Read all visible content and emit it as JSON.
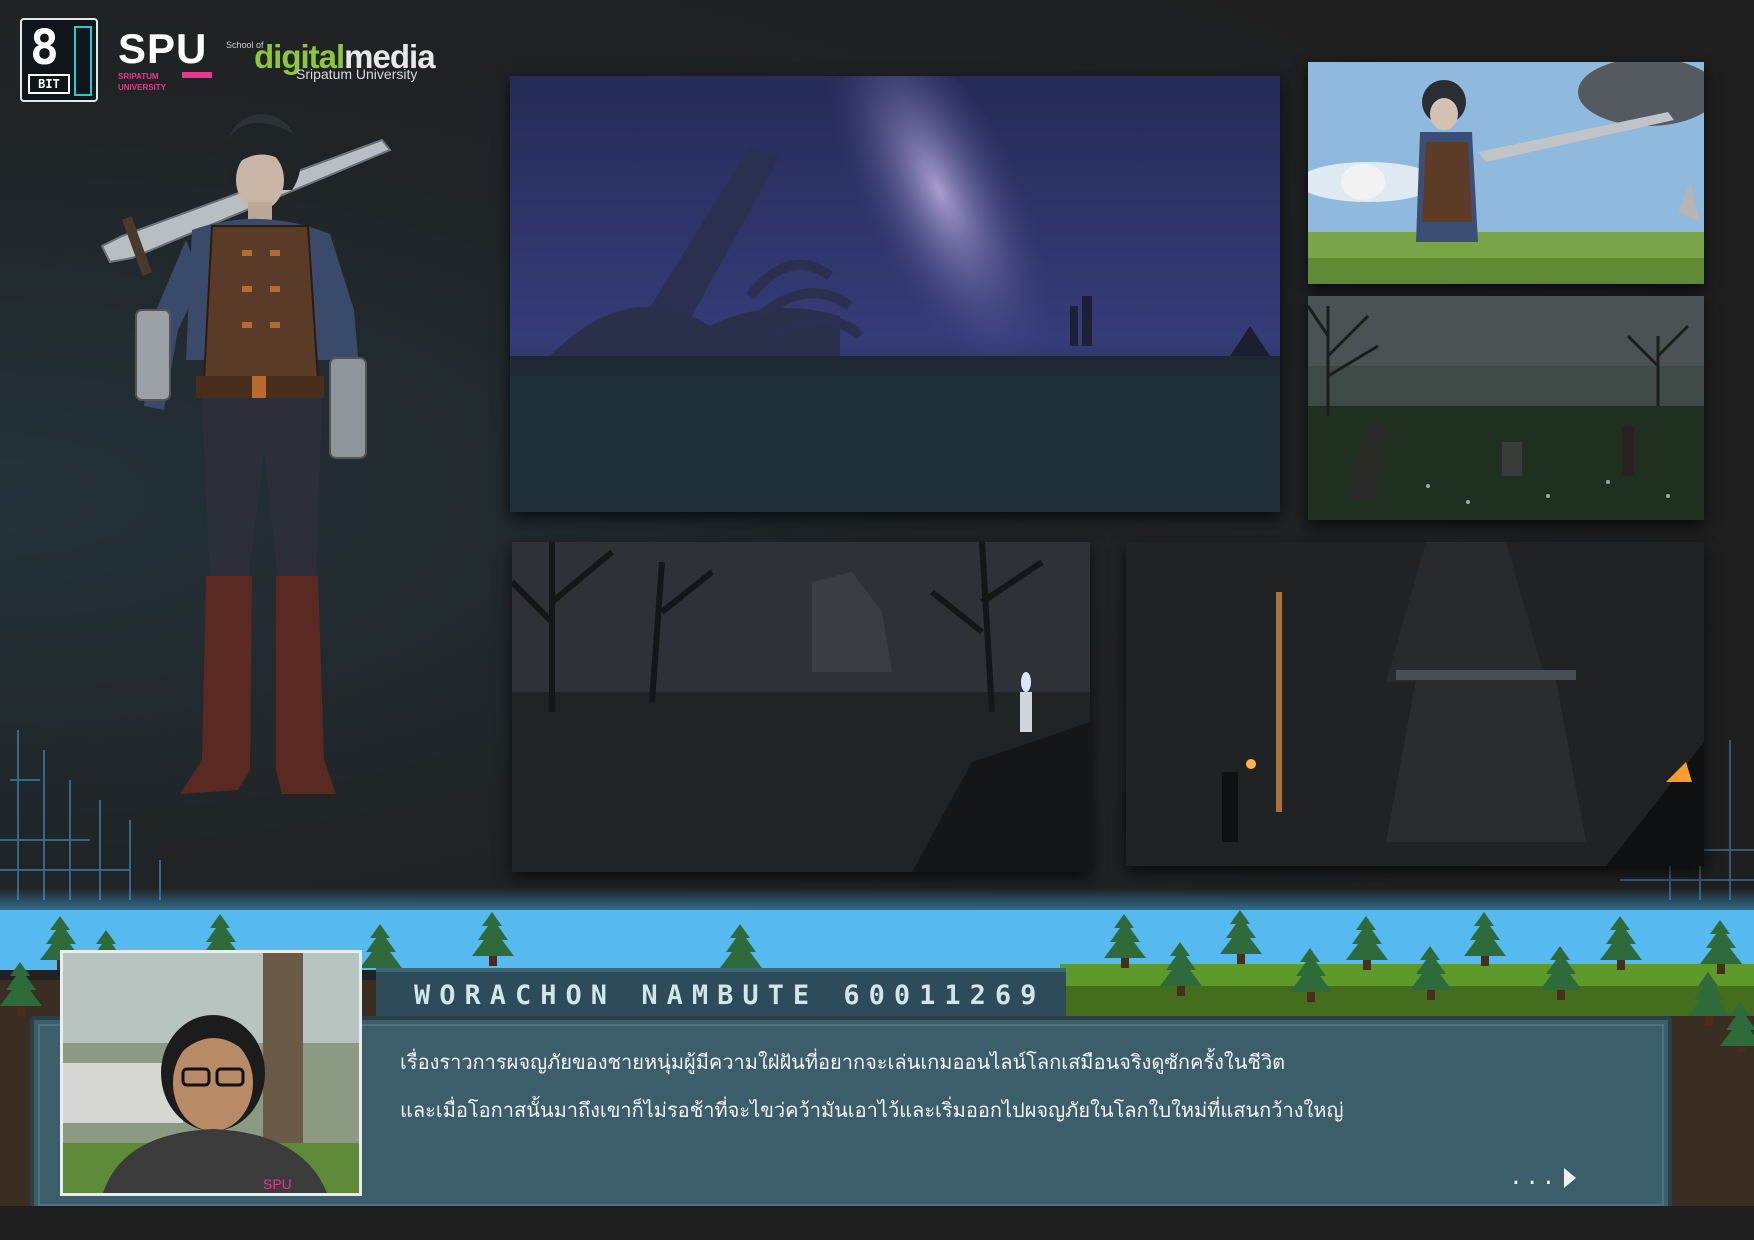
{
  "logos": {
    "eight_bit": {
      "numeral": "8",
      "label": "BIT"
    },
    "spu": {
      "title": "SPU",
      "subtitle_line1": "SRIPATUM",
      "subtitle_line2": "UNIVERSITY"
    },
    "digital_media": {
      "prefix": "School of",
      "word_green": "digital",
      "word_white": "media",
      "university": "Sripatum University"
    }
  },
  "artworks": [
    {
      "name": "night-sky-giant-skeleton",
      "caption": ""
    },
    {
      "name": "daytime-sword-hero",
      "caption": ""
    },
    {
      "name": "foggy-graveyard-field",
      "caption": ""
    },
    {
      "name": "flooded-ruins-forest",
      "caption": ""
    },
    {
      "name": "dark-temple-altar",
      "caption": ""
    }
  ],
  "dialog": {
    "name_words": [
      "WORACHON",
      "NAMBUTE",
      "60011269"
    ],
    "line1": "เรื่องราวการผจญภัยของชายหนุ่มผู้มีความใฝ่ฝันที่อยากจะเล่นเกมออนไลน์โลกเสมือนจริงดูซักครั้งในชีวิต",
    "line2": "และเมื่อโอกาสนั้นมาถึงเขาก็ไม่รอช้าที่จะไขว่คว้ามันเอาไว้และเริ่มออกไปผจญภัยในโลกใบใหม่ที่แสนกว้างใหญ่",
    "continue": "...",
    "photo_badge": "SPU"
  },
  "colors": {
    "sky": "#56baf0",
    "dialog_bg": "#3b5e6a",
    "grass": "#5e9a2a",
    "tree": "#2f6b3a",
    "brand_pink": "#e6398d",
    "brand_green": "#8dc63f"
  }
}
